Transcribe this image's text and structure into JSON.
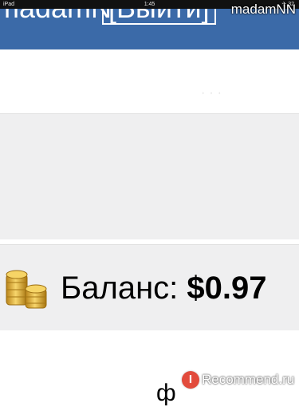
{
  "status_bar": {
    "device": "iPad",
    "time": "1:45",
    "right_indicators": "✈ 32"
  },
  "header": {
    "username": "madamN",
    "logout_label": "[Выйти]",
    "background_color": "#3b6aa8"
  },
  "watermark_top": "madamNN",
  "balance": {
    "label": "Баланс:",
    "amount": "$0.97",
    "icon": "coins-icon"
  },
  "bottom_partial_char": "ф",
  "watermark_bottom": {
    "badge": "I",
    "text": "Recommend.ru"
  }
}
